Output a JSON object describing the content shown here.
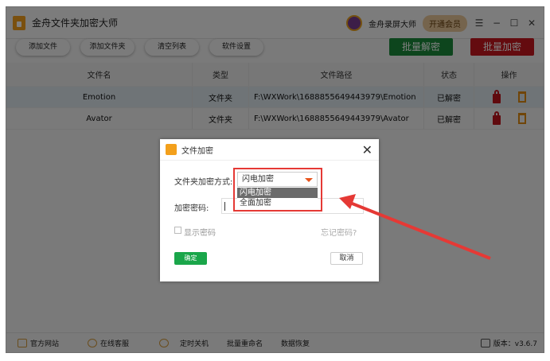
{
  "app": {
    "title": "金舟文件夹加密大师",
    "partner": "金舟录屏大师",
    "vip": "开通会员"
  },
  "toolbar": {
    "add_file": "添加文件",
    "add_folder": "添加文件夹",
    "clear": "清空列表",
    "settings": "软件设置",
    "batch_decrypt": "批量解密",
    "batch_encrypt": "批量加密"
  },
  "table": {
    "headers": [
      "文件名",
      "类型",
      "文件路径",
      "状态",
      "操作"
    ],
    "rows": [
      {
        "name": "Emotion",
        "type": "文件夹",
        "path": "F:\\WXWork\\1688855649443979\\Emotion",
        "status": "已解密"
      },
      {
        "name": "Avator",
        "type": "文件夹",
        "path": "F:\\WXWork\\1688855649443979\\Avator",
        "status": "已解密"
      }
    ]
  },
  "footer": {
    "website": "官方网站",
    "support": "在线客服",
    "shutdown": "定时关机",
    "rename": "批量重命名",
    "recovery": "数据恢复",
    "version": "版本：v3.6.7"
  },
  "dialog": {
    "title": "文件加密",
    "method_label": "文件夹加密方式:",
    "method_value": "闪电加密",
    "options": [
      "闪电加密",
      "全面加密"
    ],
    "password_label": "加密密码:",
    "password_value": "",
    "show_password": "显示密码",
    "forgot": "忘记密码?",
    "ok": "确定",
    "cancel": "取消"
  },
  "colors": {
    "green": "#1a8a3a",
    "red": "#c8161d",
    "annotation": "#e53935"
  }
}
